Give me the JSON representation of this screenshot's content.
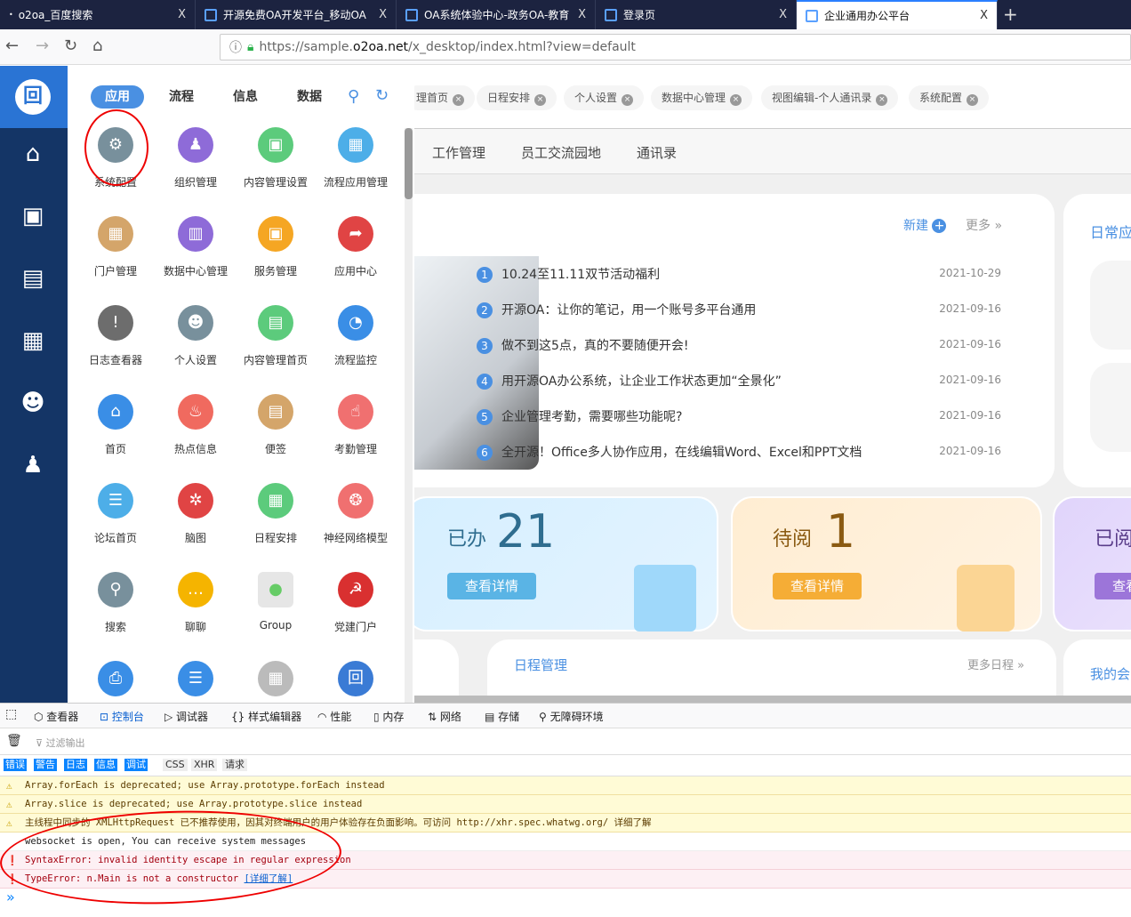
{
  "browser": {
    "tabs": [
      {
        "title": "o2oa_百度搜索"
      },
      {
        "title": "开源免费OA开发平台_移动OA"
      },
      {
        "title": "OA系统体验中心-政务OA-教育"
      },
      {
        "title": "登录页"
      },
      {
        "title": "企业通用办公平台"
      }
    ],
    "close": "X",
    "new_tab": "+",
    "url_prefix": "https://sample.",
    "url_domain": "o2oa.net",
    "url_path": "/x_desktop/index.html?view=default"
  },
  "launcher": {
    "categories": [
      "应用",
      "流程",
      "信息",
      "数据"
    ],
    "apps": [
      {
        "label": "系统配置",
        "icon": "gear-icon",
        "color": "#78909c",
        "g": "⚙"
      },
      {
        "label": "组织管理",
        "icon": "org-icon",
        "color": "#8e6bd8",
        "g": "♟"
      },
      {
        "label": "内容管理设置",
        "icon": "monitor-icon",
        "color": "#5ccb7c",
        "g": "▣"
      },
      {
        "label": "流程应用管理",
        "icon": "flow-icon",
        "color": "#4daee8",
        "g": "▦"
      },
      {
        "label": "门户管理",
        "icon": "portal-icon",
        "color": "#d4a56a",
        "g": "▦"
      },
      {
        "label": "数据中心管理",
        "icon": "chart-icon",
        "color": "#8e6bd8",
        "g": "▥"
      },
      {
        "label": "服务管理",
        "icon": "service-icon",
        "color": "#f5a623",
        "g": "▣"
      },
      {
        "label": "应用中心",
        "icon": "app-center-icon",
        "color": "#e04444",
        "g": "➦"
      },
      {
        "label": "日志查看器",
        "icon": "log-icon",
        "color": "#6d6d6d",
        "g": "!"
      },
      {
        "label": "个人设置",
        "icon": "user-settings-icon",
        "color": "#78909c",
        "g": "☻"
      },
      {
        "label": "内容管理首页",
        "icon": "news-icon",
        "color": "#5ccb7c",
        "g": "▤"
      },
      {
        "label": "流程监控",
        "icon": "gauge-icon",
        "color": "#3a8ee6",
        "g": "◔"
      },
      {
        "label": "首页",
        "icon": "home-icon",
        "color": "#3a8ee6",
        "g": "⌂"
      },
      {
        "label": "热点信息",
        "icon": "fire-icon",
        "color": "#f06a5f",
        "g": "♨"
      },
      {
        "label": "便签",
        "icon": "note-icon",
        "color": "#d4a56a",
        "g": "▤"
      },
      {
        "label": "考勤管理",
        "icon": "hand-icon",
        "color": "#f07070",
        "g": "☝"
      },
      {
        "label": "论坛首页",
        "icon": "forum-icon",
        "color": "#4daee8",
        "g": "☰"
      },
      {
        "label": "脑图",
        "icon": "mindmap-icon",
        "color": "#e04444",
        "g": "✲"
      },
      {
        "label": "日程安排",
        "icon": "calendar-icon",
        "color": "#5ccb7c",
        "g": "▦"
      },
      {
        "label": "神经网络模型",
        "icon": "brain-icon",
        "color": "#f07070",
        "g": "❂"
      },
      {
        "label": "搜索",
        "icon": "search-icon",
        "color": "#78909c",
        "g": "⚲"
      },
      {
        "label": "聊聊",
        "icon": "chat-icon",
        "color": "#f5b400",
        "g": "…"
      },
      {
        "label": "Group",
        "icon": "group-icon",
        "color": "#e6e6e6",
        "g": "●"
      },
      {
        "label": "党建门户",
        "icon": "party-icon",
        "color": "#d93030",
        "g": "☭"
      },
      {
        "label": "",
        "icon": "printer-icon",
        "color": "#3a8ee6",
        "g": "⎙"
      },
      {
        "label": "",
        "icon": "server-icon",
        "color": "#3a8ee6",
        "g": "☰"
      },
      {
        "label": "",
        "icon": "grid-icon",
        "color": "#bbbbbb",
        "g": "▦"
      },
      {
        "label": "",
        "icon": "o2-icon",
        "color": "#3a7bd5",
        "g": "回"
      }
    ]
  },
  "window_tabs": [
    "理首页",
    "日程安排",
    "个人设置",
    "数据中心管理",
    "视图编辑-个人通讯录",
    "系统配置"
  ],
  "menu": [
    "工作管理",
    "员工交流园地",
    "通讯录"
  ],
  "news": {
    "new_label": "新建",
    "more_label": "更多",
    "items": [
      {
        "n": "1",
        "title": "10.24至11.11双节活动福利",
        "date": "2021-10-29"
      },
      {
        "n": "2",
        "title": "开源OA：让你的笔记，用一个账号多平台通用",
        "date": "2021-09-16"
      },
      {
        "n": "3",
        "title": "做不到这5点，真的不要随便开会!",
        "date": "2021-09-16"
      },
      {
        "n": "4",
        "title": "用开源OA办公系统，让企业工作状态更加“全景化”",
        "date": "2021-09-16"
      },
      {
        "n": "5",
        "title": "企业管理考勤，需要哪些功能呢?",
        "date": "2021-09-16"
      },
      {
        "n": "6",
        "title": "全开源！Office多人协作应用，在线编辑Word、Excel和PPT文档",
        "date": "2021-09-16"
      }
    ]
  },
  "right_card_title": "日常应",
  "stats": [
    {
      "label": "已办",
      "value": "21",
      "button": "查看详情"
    },
    {
      "label": "待阅",
      "value": "1",
      "button": "查看详情"
    },
    {
      "label": "已阅",
      "value": "",
      "button": "查看详情"
    }
  ],
  "schedule": {
    "title": "日程管理",
    "more": "更多日程"
  },
  "meeting_title": "我的会",
  "devtools": {
    "tabs": [
      "查看器",
      "控制台",
      "调试器",
      "样式编辑器",
      "性能",
      "内存",
      "网络",
      "存储",
      "无障碍环境"
    ],
    "filter_placeholder": "过滤输出",
    "levels": [
      "错误",
      "警告",
      "日志",
      "信息",
      "调试"
    ],
    "types": [
      "CSS",
      "XHR",
      "请求"
    ],
    "messages": [
      {
        "level": "warn",
        "text": "Array.forEach is deprecated; use Array.prototype.forEach instead"
      },
      {
        "level": "warn",
        "text": "Array.slice is deprecated; use Array.prototype.slice instead"
      },
      {
        "level": "warn",
        "text": "主线程中同步的 XMLHttpRequest 已不推荐使用，因其对终端用户的用户体验存在负面影响。可访问 http://xhr.spec.whatwg.org/ 详细了解"
      },
      {
        "level": "log",
        "text": "websocket is open, You can receive system messages"
      },
      {
        "level": "err",
        "text": "SyntaxError: invalid identity escape in regular expression"
      },
      {
        "level": "err",
        "text": "TypeError: n.Main is not a constructor",
        "link": "[详细了解]"
      }
    ],
    "prompt": "»"
  }
}
